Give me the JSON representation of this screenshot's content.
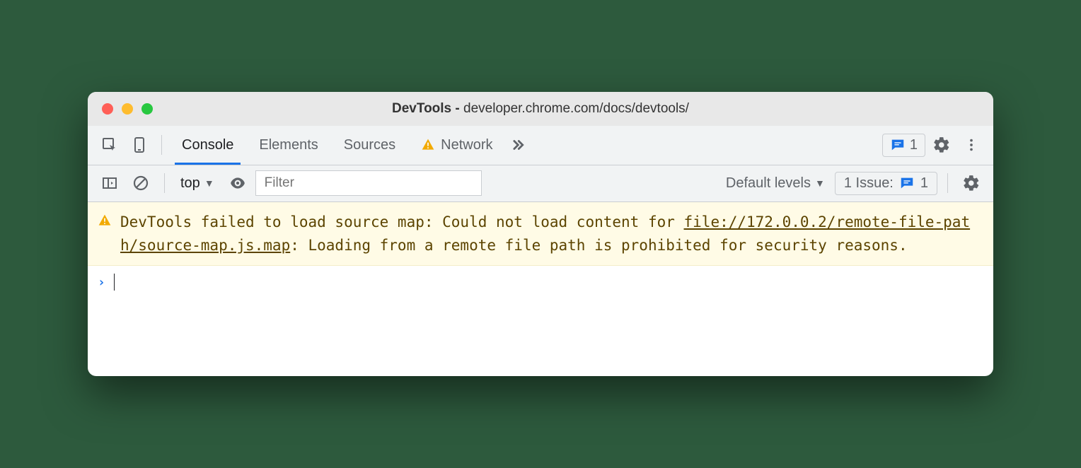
{
  "titlebar": {
    "prefix": "DevTools - ",
    "url": "developer.chrome.com/docs/devtools/"
  },
  "tabs": {
    "console": "Console",
    "elements": "Elements",
    "sources": "Sources",
    "network": "Network"
  },
  "badge_count": "1",
  "toolbar": {
    "context": "top",
    "filter_placeholder": "Filter",
    "levels": "Default levels",
    "issues_label": "1 Issue:",
    "issues_count": "1"
  },
  "warning": {
    "pre": "DevTools failed to load source map: Could not load content for ",
    "link": "file://172.0.0.2/remote-file-path/source-map.js.map",
    "post": ": Loading from a remote file path is prohibited for security reasons."
  }
}
